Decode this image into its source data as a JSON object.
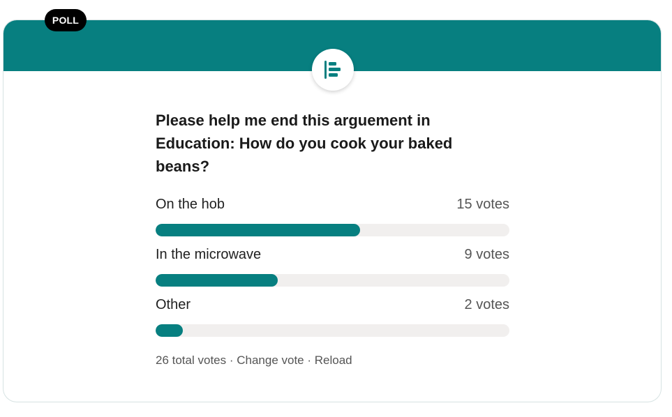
{
  "badge": "POLL",
  "colors": {
    "accent": "#077f80",
    "badge_bg": "#000000",
    "track": "#f1efee"
  },
  "icon": "poll-bar-icon",
  "question": "Please help me end this arguement in Education: How do you cook your baked beans?",
  "options": [
    {
      "label": "On the hob",
      "votes": "15 votes",
      "fraction": 0.577
    },
    {
      "label": "In the microwave",
      "votes": "9 votes",
      "fraction": 0.346
    },
    {
      "label": "Other",
      "votes": "2 votes",
      "fraction": 0.077
    }
  ],
  "footer": {
    "total": "26 total votes",
    "separator": " · ",
    "change_vote": "Change vote",
    "reload": "Reload"
  }
}
